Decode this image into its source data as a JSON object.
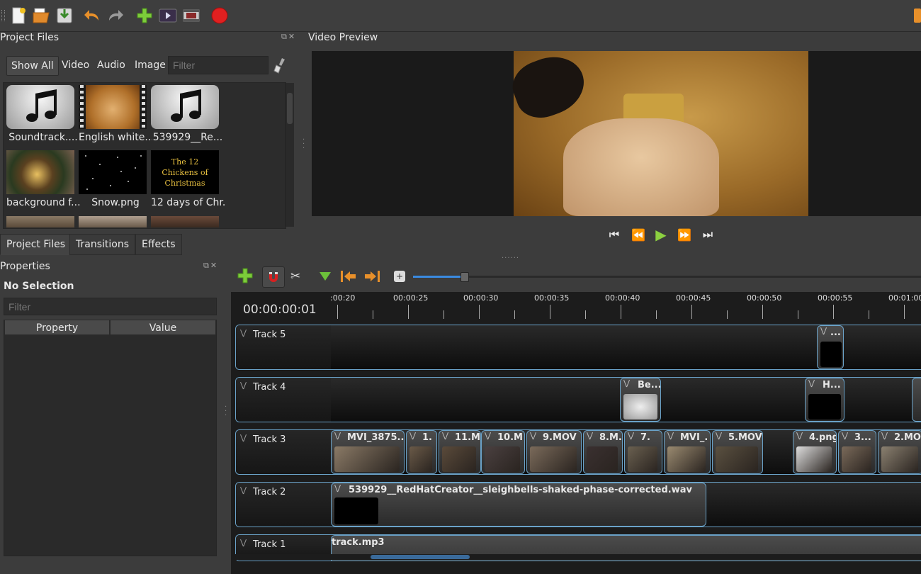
{
  "toolbar": {
    "icons": [
      "new-project-icon",
      "open-project-icon",
      "save-project-icon",
      "undo-icon",
      "redo-icon",
      "import-files-icon",
      "preview-icon",
      "fullscreen-icon",
      "record-icon"
    ]
  },
  "project_files": {
    "title": "Project Files",
    "filter_tabs": [
      "Show All",
      "Video",
      "Audio",
      "Image"
    ],
    "filter_placeholder": "Filter",
    "files": [
      {
        "label": "Soundtrack....",
        "kind": "audio"
      },
      {
        "label": "English white...",
        "kind": "video"
      },
      {
        "label": "539929__Re...",
        "kind": "audio"
      },
      {
        "label": "background f...",
        "kind": "image"
      },
      {
        "label": "Snow.png",
        "kind": "image"
      },
      {
        "label": "12 days of Chr...",
        "kind": "image",
        "thumb_text": "The 12 Chickens of Christmas"
      }
    ],
    "bottom_tabs": [
      "Project Files",
      "Transitions",
      "Effects"
    ]
  },
  "video_preview": {
    "title": "Video Preview"
  },
  "properties": {
    "title": "Properties",
    "selection": "No Selection",
    "filter_placeholder": "Filter",
    "columns": [
      "Property",
      "Value"
    ]
  },
  "timeline": {
    "timecode": "00:00:00:01",
    "ruler_labels": [
      ":00:20",
      "00:00:25",
      "00:00:30",
      "00:00:35",
      "00:00:40",
      "00:00:45",
      "00:00:50",
      "00:00:55",
      "00:01:00"
    ],
    "tracks": [
      {
        "name": "Track 5",
        "clips": [
          "..."
        ]
      },
      {
        "name": "Track 4",
        "clips": [
          "Be...",
          "H..."
        ]
      },
      {
        "name": "Track 3",
        "clips": [
          "MVI_3875....",
          "1.",
          "11.M",
          "10.M",
          "9.MOV",
          "8.M.",
          "7.",
          "MVI_.",
          "5.MOV",
          "4.png",
          "3...",
          "2.MO"
        ]
      },
      {
        "name": "Track 2",
        "clips": [
          "539929__RedHatCreator__sleighbells-shaked-phase-corrected.wav"
        ]
      },
      {
        "name": "Track 1",
        "clips": [
          "track.mp3"
        ]
      }
    ],
    "zoom_level": 0.1
  },
  "colors": {
    "accent": "#6aa2c8",
    "record": "#e02020",
    "add": "#6cc03a"
  }
}
